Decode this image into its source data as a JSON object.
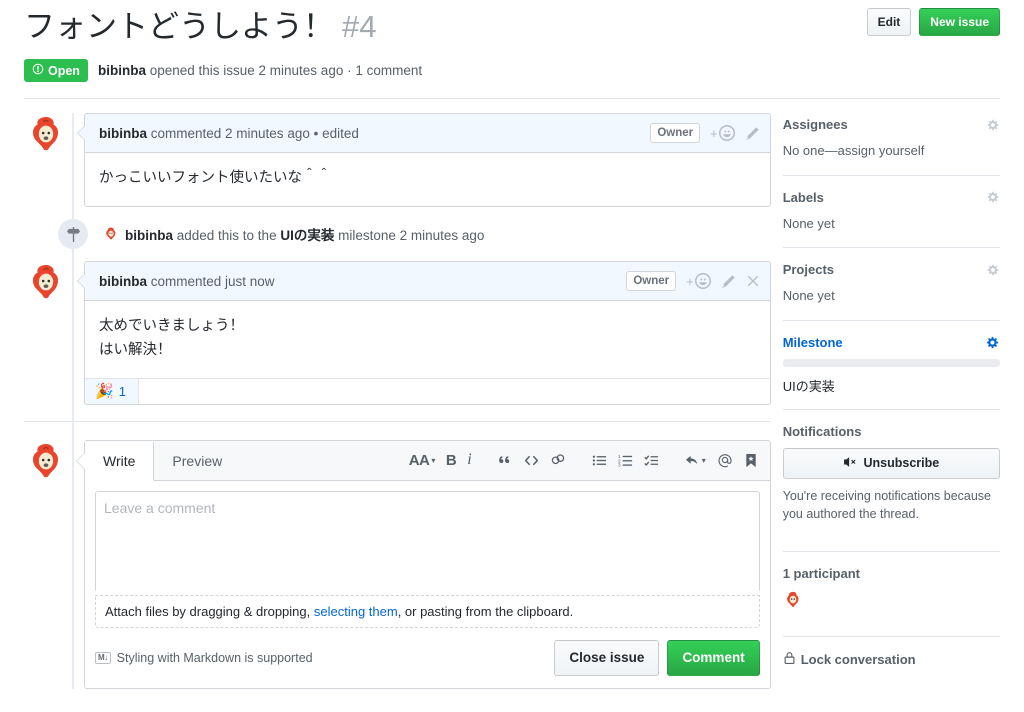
{
  "header": {
    "title": "フォントどうしよう！",
    "number": "#4",
    "edit_label": "Edit",
    "new_issue_label": "New issue",
    "state": "Open",
    "meta_author": "bibinba",
    "meta_rest": " opened this issue 2 minutes ago · 1 comment"
  },
  "timeline": {
    "comments": [
      {
        "author": "bibinba",
        "meta": " commented 2 minutes ago • edited",
        "badge": "Owner",
        "body": [
          "かっこいいフォント使いたいな＾＾"
        ],
        "actions": [
          "add-reaction",
          "edit"
        ],
        "reactions": []
      },
      {
        "author": "bibinba",
        "meta": " commented just now",
        "badge": "Owner",
        "body": [
          "太めでいきましょう！",
          "はい解決！"
        ],
        "actions": [
          "add-reaction",
          "edit",
          "close"
        ],
        "reactions": [
          {
            "emoji": "🎉",
            "count": "1"
          }
        ]
      }
    ],
    "event": {
      "actor": "bibinba",
      "text_before": " added this to the ",
      "milestone": "UIの実装",
      "text_after": " milestone 2 minutes ago"
    }
  },
  "comment_form": {
    "tabs": [
      {
        "label": "Write",
        "active": true
      },
      {
        "label": "Preview",
        "active": false
      }
    ],
    "toolbar_icons": [
      "heading-icon",
      "bold-icon",
      "italic-icon",
      "quote-icon",
      "code-icon",
      "link-icon",
      "unordered-list-icon",
      "ordered-list-icon",
      "task-list-icon",
      "reply-icon",
      "mention-icon",
      "saved-replies-icon"
    ],
    "heading_label": "AA",
    "bold_label": "B",
    "italic_label": "i",
    "textarea_placeholder": "Leave a comment",
    "textarea_value": "",
    "attach_prefix": "Attach files by dragging & dropping, ",
    "attach_link": "selecting them",
    "attach_suffix": ", or pasting from the clipboard.",
    "markdown_note": "Styling with Markdown is supported",
    "markdown_icon_label": "M↓",
    "close_issue_label": "Close issue",
    "comment_label": "Comment"
  },
  "sidebar": {
    "assignees": {
      "title": "Assignees",
      "value": "No one—assign yourself"
    },
    "labels": {
      "title": "Labels",
      "value": "None yet"
    },
    "projects": {
      "title": "Projects",
      "value": "None yet"
    },
    "milestone": {
      "title": "Milestone",
      "name": "UIの実装",
      "progress_percent": 0
    },
    "notifications": {
      "title": "Notifications",
      "button_label": "Unsubscribe",
      "note": "You're receiving notifications because you authored the thread."
    },
    "participants": {
      "title": "1 participant"
    },
    "lock": {
      "label": "Lock conversation"
    }
  },
  "colors": {
    "green": "#2cbe4e",
    "blue": "#0366d6",
    "header_bg": "#f1f8ff",
    "border": "#d1d5da"
  }
}
